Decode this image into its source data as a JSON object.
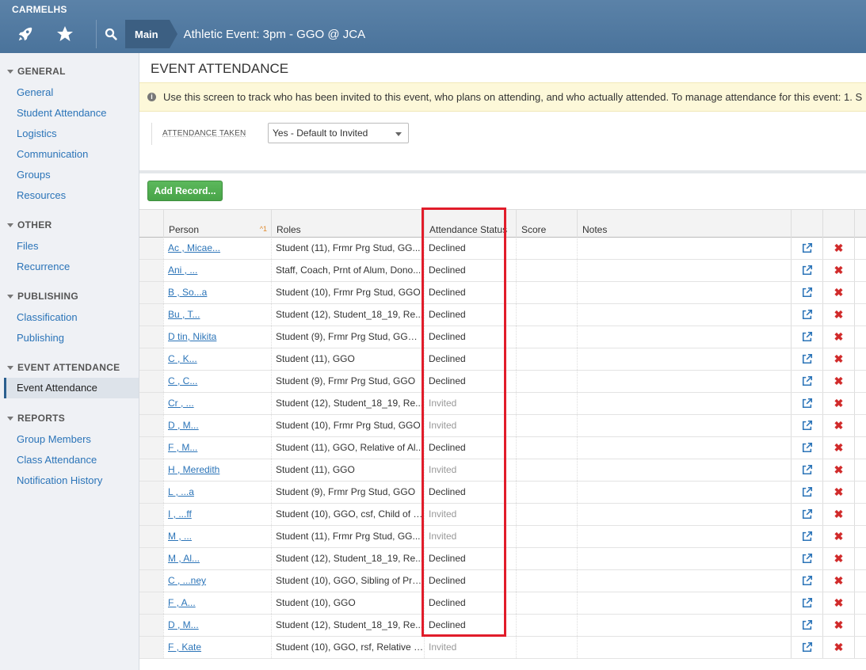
{
  "header": {
    "org": "CARMELHS",
    "breadcrumb_main": "Main",
    "breadcrumb_title": "Athletic Event: 3pm - GGO @ JCA"
  },
  "sidebar": {
    "sections": [
      {
        "title": "GENERAL",
        "items": [
          "General",
          "Student Attendance",
          "Logistics",
          "Communication",
          "Groups",
          "Resources"
        ]
      },
      {
        "title": "OTHER",
        "items": [
          "Files",
          "Recurrence"
        ]
      },
      {
        "title": "PUBLISHING",
        "items": [
          "Classification",
          "Publishing"
        ]
      },
      {
        "title": "EVENT ATTENDANCE",
        "items": [
          "Event Attendance"
        ]
      },
      {
        "title": "REPORTS",
        "items": [
          "Group Members",
          "Class Attendance",
          "Notification History"
        ]
      }
    ],
    "active_item": "Event Attendance"
  },
  "main": {
    "title": "EVENT ATTENDANCE",
    "info_text": "Use this screen to track who has been invited to this event, who plans on attending, and who actually attended. To manage attendance for this event: 1. S",
    "attendance_taken_label": "ATTENDANCE TAKEN",
    "attendance_taken_value": "Yes - Default to Invited",
    "add_record_label": "Add Record..."
  },
  "table": {
    "columns": [
      "Person",
      "Roles",
      "Attendance Status",
      "Score",
      "Notes"
    ],
    "sort_indicator": "^1",
    "rows": [
      {
        "person": "Ac       , Micae...",
        "roles": "Student (11), Frmr Prg Stud, GG...",
        "status": "Declined"
      },
      {
        "person": "Ani    , ...",
        "roles": "Staff, Coach, Prnt of Alum, Dono...",
        "status": "Declined"
      },
      {
        "person": "B      , So...a",
        "roles": "Student (10), Frmr Prg Stud, GGO",
        "status": "Declined"
      },
      {
        "person": "Bu       , T...",
        "roles": "Student (12), Student_18_19, Re...",
        "status": "Declined"
      },
      {
        "person": "D     tin, Nikita",
        "roles": "Student (9), Frmr Prg Stud, GGO,...",
        "status": "Declined"
      },
      {
        "person": "C      , K...",
        "roles": "Student (11), GGO",
        "status": "Declined"
      },
      {
        "person": "C      , C...",
        "roles": "Student (9), Frmr Prg Stud, GGO",
        "status": "Declined"
      },
      {
        "person": "Cr       , ...",
        "roles": "Student (12), Student_18_19, Re...",
        "status": "Invited"
      },
      {
        "person": "D     , M...",
        "roles": "Student (10), Frmr Prg Stud, GGO",
        "status": "Invited"
      },
      {
        "person": "F      , M...",
        "roles": "Student (11), GGO, Relative of Al...",
        "status": "Declined"
      },
      {
        "person": "H      , Meredith",
        "roles": "Student (11), GGO",
        "status": "Invited"
      },
      {
        "person": "L      , ...a",
        "roles": "Student (9), Frmr Prg Stud, GGO",
        "status": "Declined"
      },
      {
        "person": "I      , ...ff",
        "roles": "Student (10), GGO, csf, Child of F...",
        "status": "Invited"
      },
      {
        "person": "M      , ...",
        "roles": "Student (11), Frmr Prg Stud, GG...",
        "status": "Invited"
      },
      {
        "person": "M      , Al...",
        "roles": "Student (12), Student_18_19, Re...",
        "status": "Declined"
      },
      {
        "person": "C      , ...ney",
        "roles": "Student (10), GGO, Sibling of Pro...",
        "status": "Declined"
      },
      {
        "person": "F      , A...",
        "roles": "Student (10), GGO",
        "status": "Declined"
      },
      {
        "person": "D      , M...",
        "roles": "Student (12), Student_18_19, Re...",
        "status": "Declined"
      },
      {
        "person": "F      , Kate",
        "roles": "Student (10), GGO, rsf, Relative o...",
        "status": "Invited"
      }
    ]
  },
  "icons": {
    "rocket": "rocket-icon",
    "star": "star-icon",
    "search": "search-icon",
    "open": "external-link-icon",
    "delete": "delete-x-icon",
    "info": "info-icon"
  },
  "colors": {
    "highlight_border": "#e11c2a",
    "declined": "#333333",
    "invited": "#999999",
    "link": "#2b74b8"
  }
}
